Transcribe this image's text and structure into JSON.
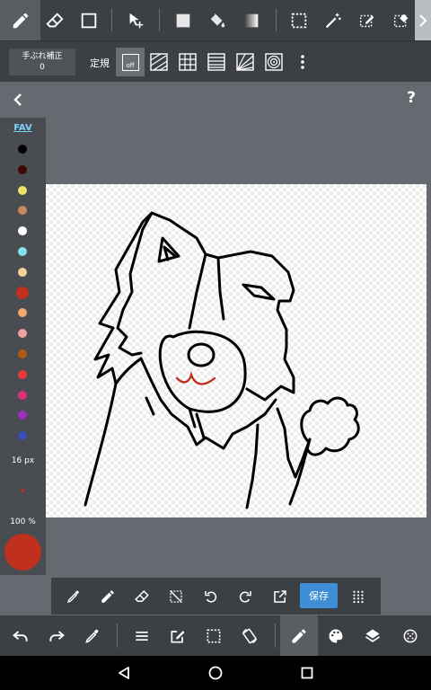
{
  "top_toolbar": {
    "tools": [
      "brush-tool",
      "eraser-tool",
      "shape-tool",
      "move-tool",
      "fill-rect-tool",
      "bucket-tool",
      "gradient-tool",
      "select-tool",
      "magic-wand-tool",
      "select-pen-tool",
      "select-eraser-tool"
    ],
    "active_tool": "brush-tool"
  },
  "second_toolbar": {
    "stabilizer_label": "手ぶれ補正",
    "stabilizer_value": "0",
    "ruler_label": "定規",
    "ruler_off_label": "off"
  },
  "palette": {
    "fav_label": "FAV",
    "colors": [
      "#000000",
      "#3b0a05",
      "#f0e06a",
      "#c9875a",
      "#ffffff",
      "#7fe3f0",
      "#f4d29a",
      "#c0301e",
      "#f0a870",
      "#f0a0a0",
      "#b35a10",
      "#e83a3a",
      "#e0307a",
      "#9a30c0",
      "#3a50b8"
    ],
    "selected_color": "#c0301e",
    "brush_size_label": "16 px",
    "opacity_label": "100 %"
  },
  "quick_bar": {
    "save_label": "保存"
  },
  "help_label": "?"
}
